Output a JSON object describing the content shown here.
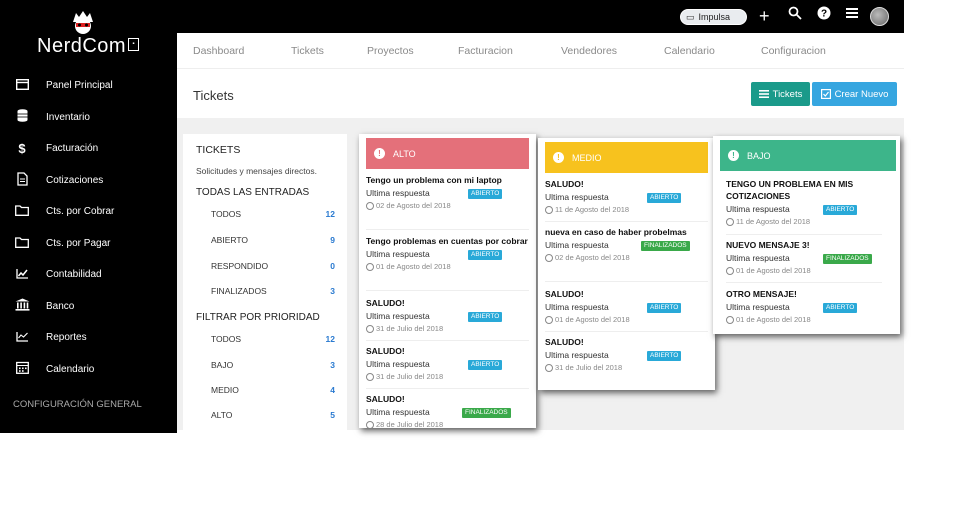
{
  "topbar": {
    "impulsa_label": "Impulsa",
    "icons": [
      "plus-icon",
      "search-icon",
      "help-icon",
      "menu-icon",
      "avatar"
    ]
  },
  "brand": {
    "name": "NerdCom"
  },
  "sidebar": {
    "items": [
      {
        "label": "Panel Principal",
        "icon": "window-icon"
      },
      {
        "label": "Inventario",
        "icon": "database-icon"
      },
      {
        "label": "Facturación",
        "icon": "dollar-icon"
      },
      {
        "label": "Cotizaciones",
        "icon": "document-icon"
      },
      {
        "label": "Cts. por Cobrar",
        "icon": "folder-icon"
      },
      {
        "label": "Cts. por Pagar",
        "icon": "folder-icon"
      },
      {
        "label": "Contabilidad",
        "icon": "chart-icon"
      },
      {
        "label": "Banco",
        "icon": "bank-icon"
      },
      {
        "label": "Reportes",
        "icon": "chart-line-icon"
      },
      {
        "label": "Calendario",
        "icon": "calendar-icon"
      }
    ],
    "footer": "CONFIGURACIÓN GENERAL"
  },
  "tabs": [
    "Dashboard",
    "Tickets",
    "Proyectos",
    "Facturacion",
    "Vendedores",
    "Calendario",
    "Configuracion"
  ],
  "page": {
    "title": "Tickets",
    "btn_tickets": "Tickets",
    "btn_nuevo": "Crear Nuevo"
  },
  "filters": {
    "title": "TICKETS",
    "subtitle": "Solicitudes y mensajes directos.",
    "all_title": "TODAS LAS ENTRADAS",
    "all": [
      {
        "label": "TODOS",
        "count": "12"
      },
      {
        "label": "ABIERTO",
        "count": "9"
      },
      {
        "label": "RESPONDIDO",
        "count": "0"
      },
      {
        "label": "FINALIZADOS",
        "count": "3"
      }
    ],
    "prio_title": "FILTRAR POR PRIORIDAD",
    "prio": [
      {
        "label": "TODOS",
        "count": "12"
      },
      {
        "label": "BAJO",
        "count": "3"
      },
      {
        "label": "MEDIO",
        "count": "4"
      },
      {
        "label": "ALTO",
        "count": "5"
      }
    ]
  },
  "columns": {
    "alto": {
      "label": "ALTO",
      "color": "#e4707a",
      "tickets": [
        {
          "title": "Tengo un problema con mi laptop",
          "reply": "Ultima respuesta",
          "status": "ABIERTO",
          "date": "02 de Agosto del 2018"
        },
        {
          "title": "Tengo problemas en cuentas por cobrar",
          "reply": "Ultima respuesta",
          "status": "ABIERTO",
          "date": "01 de Agosto del 2018"
        },
        {
          "title": "SALUDO!",
          "reply": "Ultima respuesta",
          "status": "ABIERTO",
          "date": "31 de Julio del 2018"
        },
        {
          "title": "SALUDO!",
          "reply": "Ultima respuesta",
          "status": "ABIERTO",
          "date": "31 de Julio del 2018"
        },
        {
          "title": "SALUDO!",
          "reply": "Ultima respuesta",
          "status": "FINALIZADOS",
          "date": "28 de Julio del 2018"
        }
      ]
    },
    "medio": {
      "label": "MEDIO",
      "color": "#f7c21e",
      "tickets": [
        {
          "title": "SALUDO!",
          "reply": "Ultima respuesta",
          "status": "ABIERTO",
          "date": "11 de Agosto del 2018"
        },
        {
          "title": "nueva en caso de haber probelmas",
          "reply": "Ultima respuesta",
          "status": "FINALIZADOS",
          "date": "02 de Agosto del 2018"
        },
        {
          "title": "SALUDO!",
          "reply": "Ultima respuesta",
          "status": "ABIERTO",
          "date": "01 de Agosto del 2018"
        },
        {
          "title": "SALUDO!",
          "reply": "Ultima respuesta",
          "status": "ABIERTO",
          "date": "31 de Julio del 2018"
        }
      ]
    },
    "bajo": {
      "label": "BAJO",
      "color": "#3db58a",
      "tickets": [
        {
          "title": "TENGO UN PROBLEMA EN MIS COTIZACIONES",
          "reply": "Ultima respuesta",
          "status": "ABIERTO",
          "date": "11 de Agosto del 2018"
        },
        {
          "title": "NUEVO MENSAJE 3!",
          "reply": "Ultima respuesta",
          "status": "FINALIZADOS",
          "date": "01 de Agosto del 2018"
        },
        {
          "title": "OTRO MENSAJE!",
          "reply": "Ultima respuesta",
          "status": "ABIERTO",
          "date": "01 de Agosto del 2018"
        }
      ]
    }
  }
}
